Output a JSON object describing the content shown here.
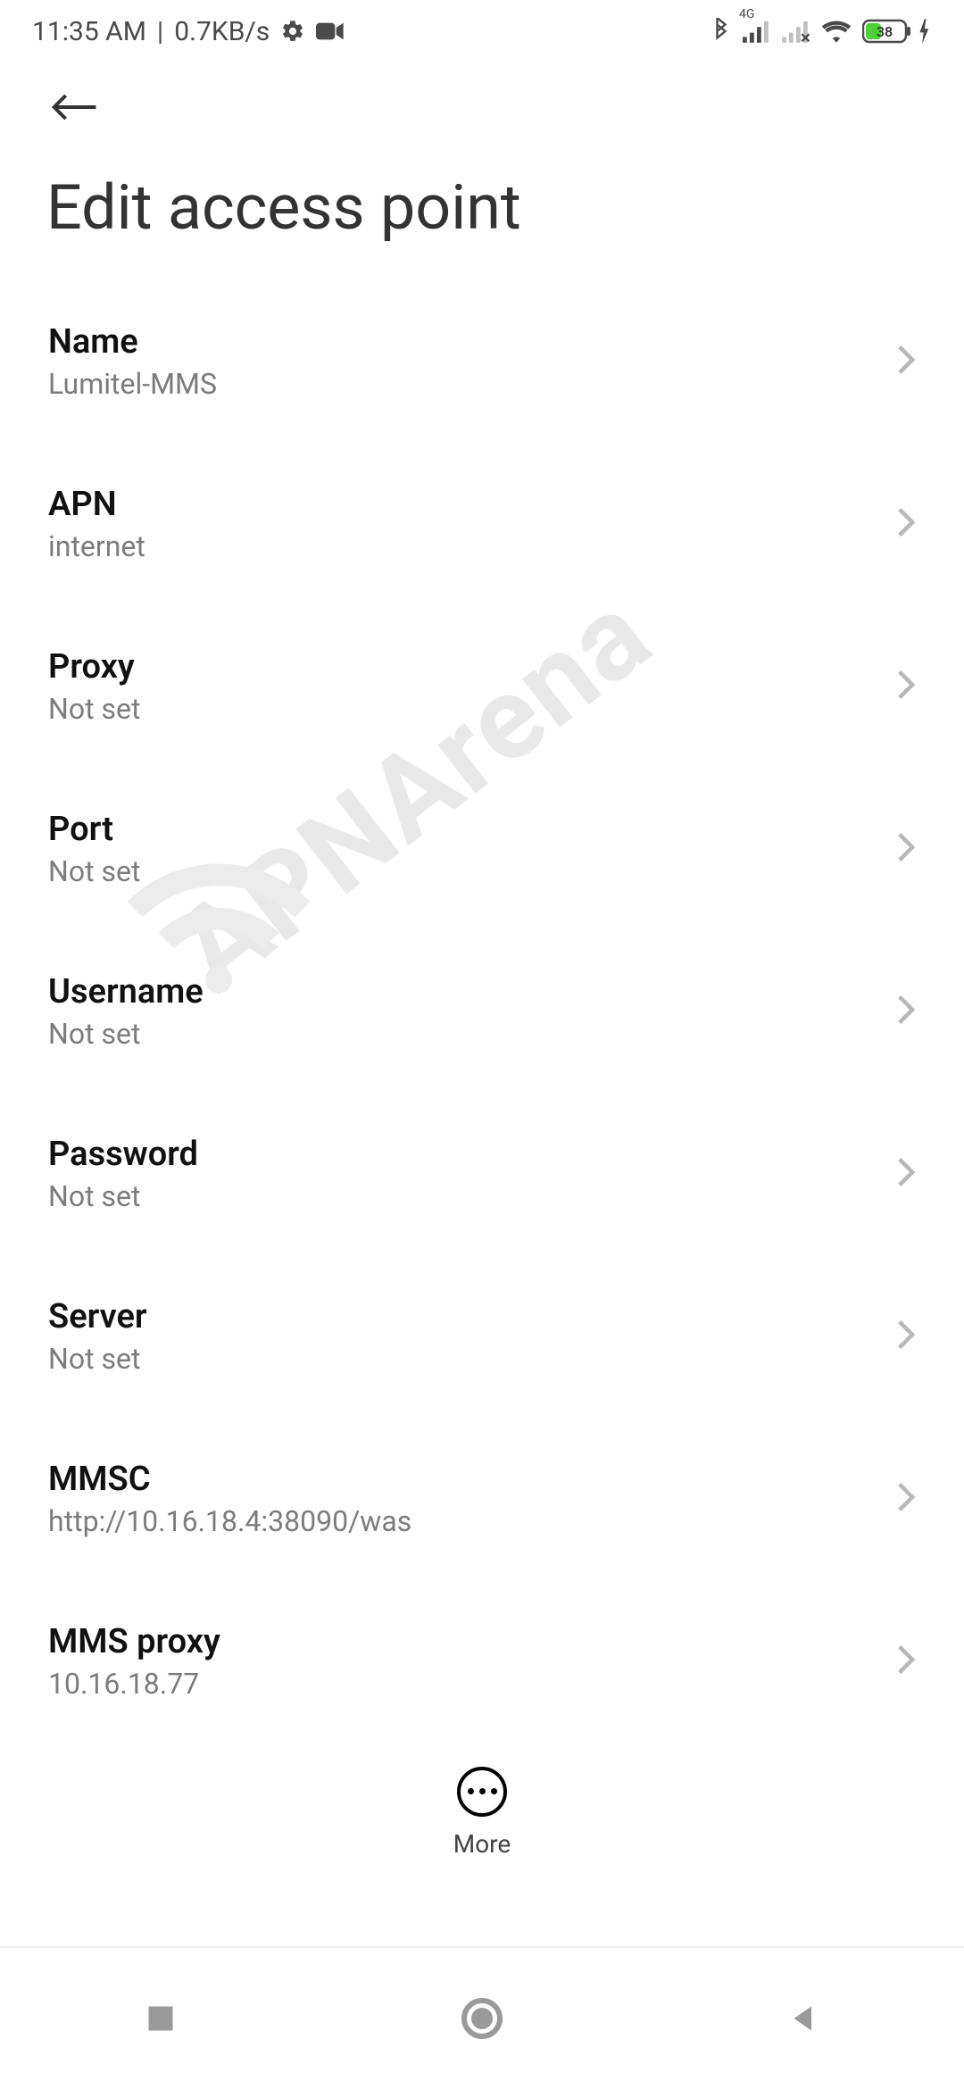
{
  "statusbar": {
    "time": "11:35 AM",
    "speed": "0.7KB/s",
    "net_label": "4G",
    "battery": "38"
  },
  "header": {
    "title": "Edit access point"
  },
  "settings": [
    {
      "label": "Name",
      "value": "Lumitel-MMS"
    },
    {
      "label": "APN",
      "value": "internet"
    },
    {
      "label": "Proxy",
      "value": "Not set"
    },
    {
      "label": "Port",
      "value": "Not set"
    },
    {
      "label": "Username",
      "value": "Not set"
    },
    {
      "label": "Password",
      "value": "Not set"
    },
    {
      "label": "Server",
      "value": "Not set"
    },
    {
      "label": "MMSC",
      "value": "http://10.16.18.4:38090/was"
    },
    {
      "label": "MMS proxy",
      "value": "10.16.18.77"
    }
  ],
  "footer": {
    "more_label": "More"
  },
  "watermark": "APNArena"
}
